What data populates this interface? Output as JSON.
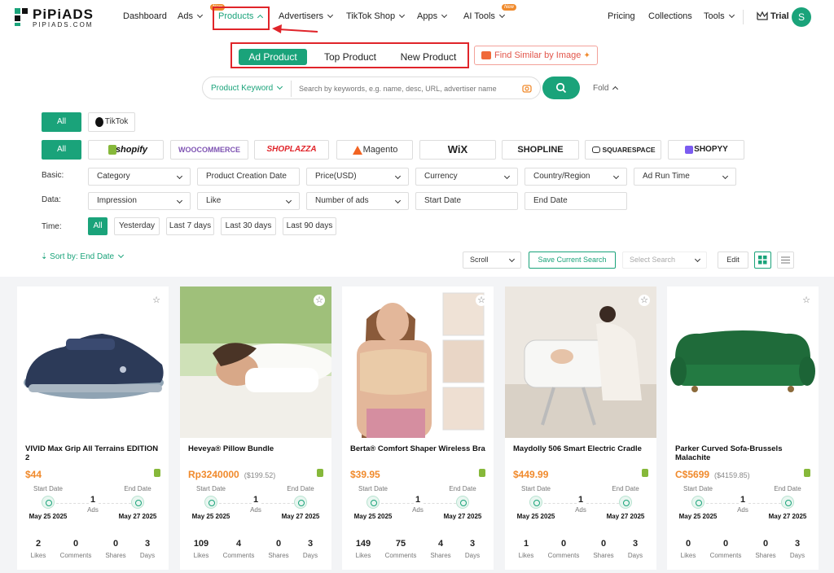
{
  "logo": {
    "name": "PiPiADS",
    "sub": "PIPIADS.COM"
  },
  "nav": {
    "dashboard": "Dashboard",
    "ads": "Ads",
    "ads_badge": "New",
    "products": "Products",
    "advertisers": "Advertisers",
    "tiktok_shop": "TikTok Shop",
    "apps": "Apps",
    "ai_tools": "AI Tools",
    "ai_badge": "New",
    "pricing": "Pricing",
    "collections": "Collections",
    "tools": "Tools",
    "trial": "Trial",
    "avatar": "S"
  },
  "tabs": [
    "Ad Product",
    "Top Product",
    "New Product"
  ],
  "find_similar": "Find Similar by Image",
  "search": {
    "type": "Product Keyword",
    "placeholder": "Search by keywords, e.g. name, desc, URL, advertiser name",
    "fold": "Fold"
  },
  "filters": {
    "platform_all": "All",
    "tiktok": "TikTok",
    "store_all": "All",
    "stores": [
      "shopify",
      "WOOCOMMERCE",
      "SHOPLAZZA",
      "Magento",
      "WiX",
      "SHOPLINE",
      "SQUARESPACE",
      "SHOPYY"
    ],
    "basic_label": "Basic:",
    "basic": [
      "Category",
      "Product Creation Date",
      "Price(USD)",
      "Currency",
      "Country/Region",
      "Ad Run Time"
    ],
    "data_label": "Data:",
    "data": [
      "Impression",
      "Like",
      "Number of ads",
      "Start Date",
      "End Date"
    ],
    "time_label": "Time:",
    "time": [
      "All",
      "Yesterday",
      "Last 7 days",
      "Last 30 days",
      "Last 90 days"
    ]
  },
  "toolbar": {
    "sort": "Sort by: End Date",
    "scroll": "Scroll",
    "save": "Save Current Search",
    "select_search": "Select Search",
    "edit": "Edit"
  },
  "cards": [
    {
      "title": "VIVID Max Grip All Terrains EDITION 2",
      "price": "$44",
      "orig": "",
      "start_label": "Start Date",
      "end_label": "End Date",
      "ads": "1",
      "ads_label": "Ads",
      "start": "May 25 2025",
      "end": "May 27 2025",
      "likes": "2",
      "comments": "0",
      "shares": "0",
      "days": "3"
    },
    {
      "title": "Heveya® Pillow Bundle",
      "price": "Rp3240000",
      "orig": "($199.52)",
      "start_label": "Start Date",
      "end_label": "End Date",
      "ads": "1",
      "ads_label": "Ads",
      "start": "May 25 2025",
      "end": "May 27 2025",
      "likes": "109",
      "comments": "4",
      "shares": "0",
      "days": "3"
    },
    {
      "title": "Berta® Comfort Shaper Wireless Bra",
      "price": "$39.95",
      "orig": "",
      "start_label": "Start Date",
      "end_label": "End Date",
      "ads": "1",
      "ads_label": "Ads",
      "start": "May 25 2025",
      "end": "May 27 2025",
      "likes": "149",
      "comments": "75",
      "shares": "4",
      "days": "3"
    },
    {
      "title": "Maydolly 506 Smart Electric Cradle",
      "price": "$449.99",
      "orig": "",
      "start_label": "Start Date",
      "end_label": "End Date",
      "ads": "1",
      "ads_label": "Ads",
      "start": "May 25 2025",
      "end": "May 27 2025",
      "likes": "1",
      "comments": "0",
      "shares": "0",
      "days": "3"
    },
    {
      "title": "Parker Curved Sofa-Brussels Malachite",
      "price": "C$5699",
      "orig": "($4159.85)",
      "start_label": "Start Date",
      "end_label": "End Date",
      "ads": "1",
      "ads_label": "Ads",
      "start": "May 25 2025",
      "end": "May 27 2025",
      "likes": "0",
      "comments": "0",
      "shares": "0",
      "days": "3"
    }
  ],
  "stat_labels": {
    "likes": "Likes",
    "comments": "Comments",
    "shares": "Shares",
    "days": "Days"
  },
  "colors": {
    "accent": "#1aa37a",
    "price": "#f08a2c",
    "highlight": "#e0242a"
  }
}
